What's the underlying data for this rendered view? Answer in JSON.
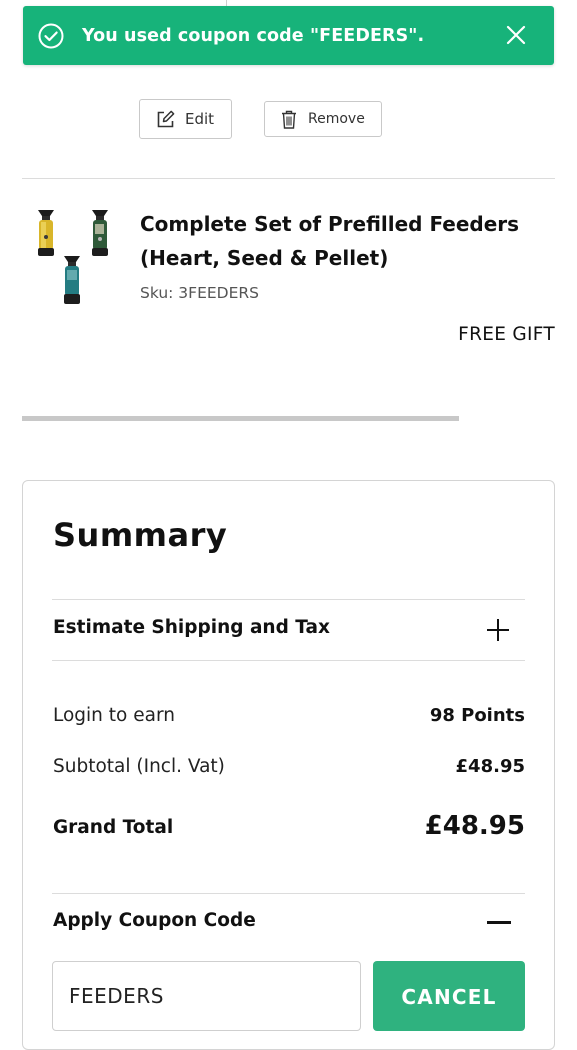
{
  "toast": {
    "message": "You used coupon code \"FEEDERS\".",
    "color": "#17b37a",
    "icon": "check-circle-icon",
    "close_icon": "close-icon"
  },
  "item_actions": {
    "edit_label": "Edit",
    "remove_label": "Remove"
  },
  "product": {
    "title_line1": "Complete Set of Prefilled Feeders",
    "title_line2": "(Heart, Seed & Pellet)",
    "sku": "Sku: 3FEEDERS",
    "price": "FREE GIFT"
  },
  "summary": {
    "title": "Summary",
    "estimate_label": "Estimate Shipping and Tax",
    "rows": [
      {
        "label": "Login to earn",
        "value": "98 Points"
      },
      {
        "label": "Subtotal (Incl. Vat)",
        "value": "£48.95"
      }
    ],
    "grand_total_label": "Grand Total",
    "grand_total_value": "£48.95",
    "coupon_label": "Apply Coupon Code",
    "coupon_value": "FEEDERS",
    "cancel_label": "CANCEL",
    "accent": "#2fb27f"
  }
}
